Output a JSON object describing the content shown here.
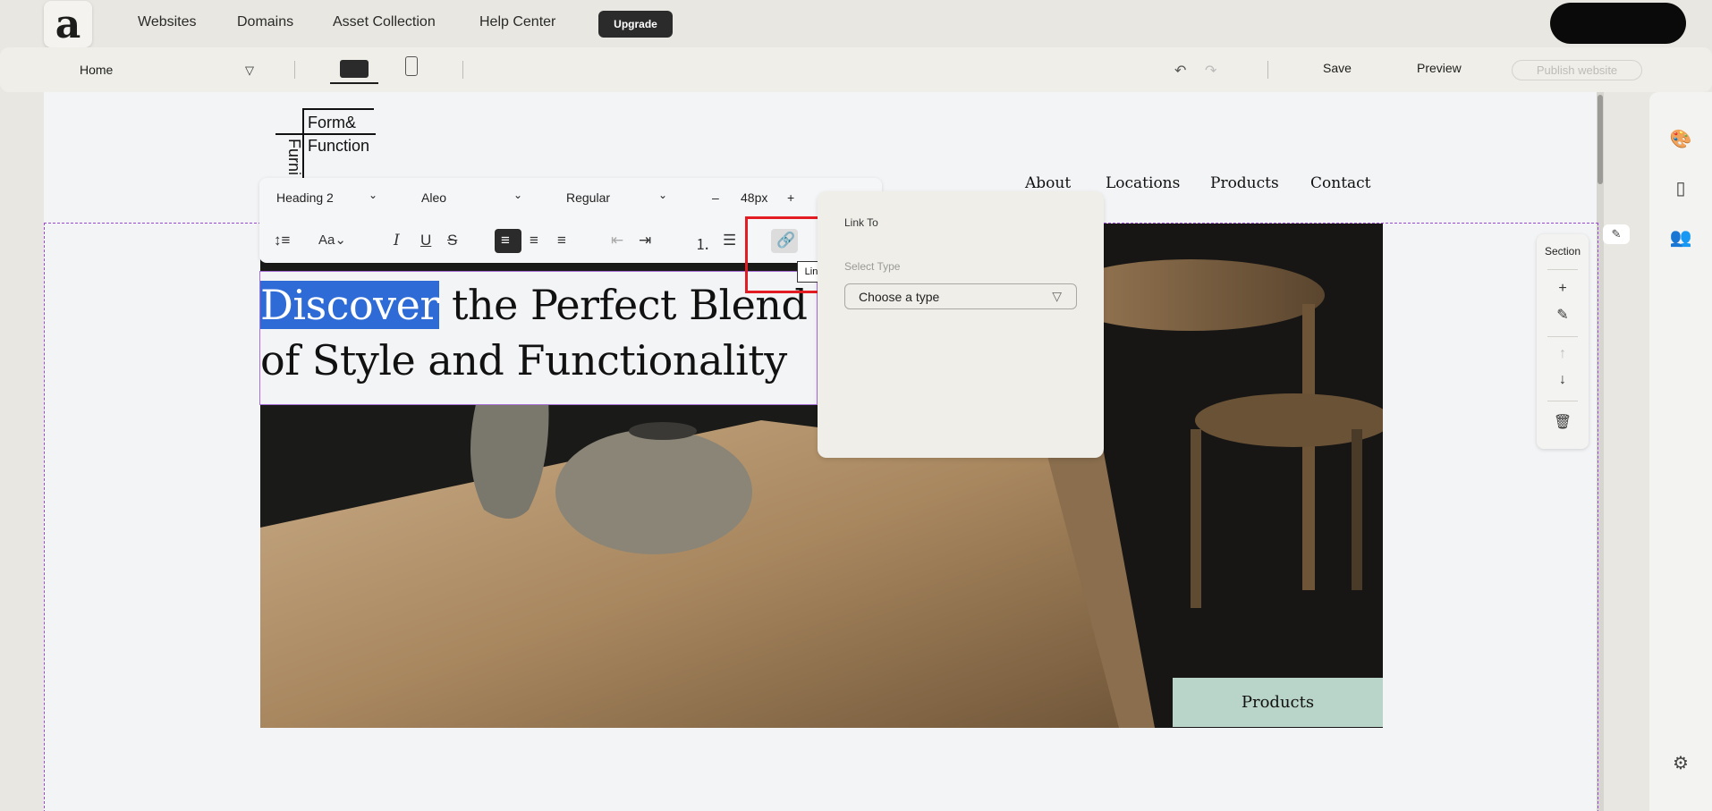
{
  "topnav": {
    "logo": "a",
    "links": [
      "Websites",
      "Domains",
      "Asset Collection",
      "Help Center"
    ],
    "upgrade": "Upgrade"
  },
  "toolbar": {
    "page": "Home",
    "save": "Save",
    "preview": "Preview",
    "publish": "Publish website"
  },
  "site": {
    "logo_line1": "Form&",
    "logo_line2": "Function",
    "logo_vertical": "Furni",
    "nav": [
      "About",
      "Locations",
      "Products",
      "Contact"
    ],
    "heading_highlight": "Discover",
    "heading_rest": " the Perfect Blend of Style and Functionality",
    "products_button": "Products"
  },
  "richtext": {
    "style": "Heading 2",
    "font": "Aleo",
    "weight": "Regular",
    "size": "48px",
    "minus": "–",
    "plus": "+"
  },
  "link_panel": {
    "title": "Link To",
    "select_label": "Select Type",
    "select_value": "Choose a type",
    "tooltip": "Link To"
  },
  "section_tools": {
    "label": "Section"
  }
}
